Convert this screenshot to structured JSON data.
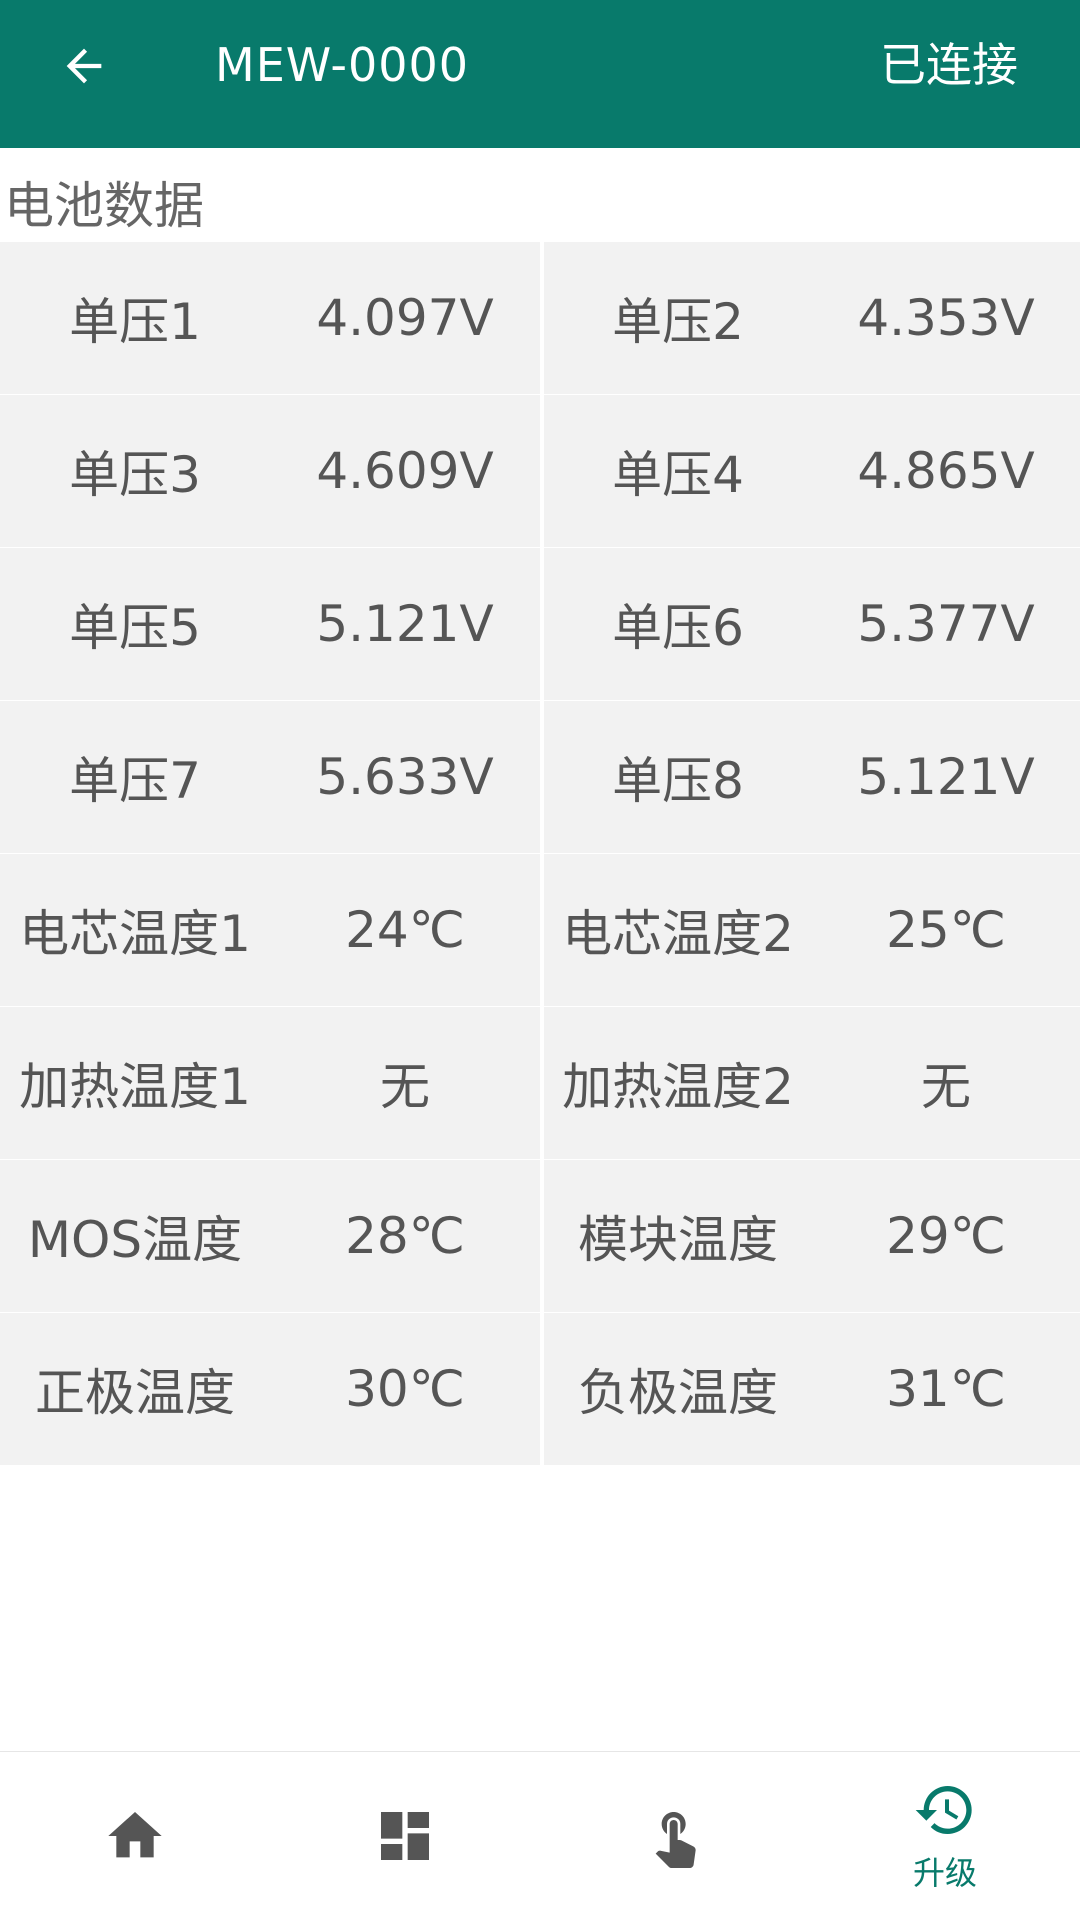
{
  "colors": {
    "header_bg": "#087a6b",
    "accent": "#087a6b",
    "cell_bg": "#f2f2f2",
    "text": "#555555",
    "icon_inactive": "#555555"
  },
  "header": {
    "back_icon": "arrow-left-icon",
    "title": "MEW-0000",
    "status": "已连接"
  },
  "section": {
    "title": "电池数据"
  },
  "rows": [
    [
      {
        "label": "单压1",
        "value": "4.097V"
      },
      {
        "label": "单压2",
        "value": "4.353V"
      }
    ],
    [
      {
        "label": "单压3",
        "value": "4.609V"
      },
      {
        "label": "单压4",
        "value": "4.865V"
      }
    ],
    [
      {
        "label": "单压5",
        "value": "5.121V"
      },
      {
        "label": "单压6",
        "value": "5.377V"
      }
    ],
    [
      {
        "label": "单压7",
        "value": "5.633V"
      },
      {
        "label": "单压8",
        "value": "5.121V"
      }
    ],
    [
      {
        "label": "电芯温度1",
        "value": "24℃"
      },
      {
        "label": "电芯温度2",
        "value": "25℃"
      }
    ],
    [
      {
        "label": "加热温度1",
        "value": "无"
      },
      {
        "label": "加热温度2",
        "value": "无"
      }
    ],
    [
      {
        "label": "MOS温度",
        "value": "28℃"
      },
      {
        "label": "模块温度",
        "value": "29℃"
      }
    ],
    [
      {
        "label": "正极温度",
        "value": "30℃"
      },
      {
        "label": "负极温度",
        "value": "31℃"
      }
    ]
  ],
  "nav": [
    {
      "icon": "home-icon",
      "label": "",
      "active": false
    },
    {
      "icon": "dashboard-icon",
      "label": "",
      "active": false
    },
    {
      "icon": "touch-icon",
      "label": "",
      "active": false
    },
    {
      "icon": "history-icon",
      "label": "升级",
      "active": true
    }
  ]
}
